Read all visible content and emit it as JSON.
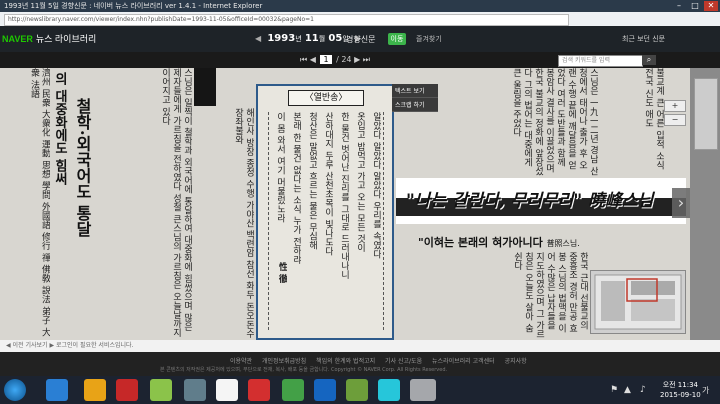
{
  "window": {
    "title": "1993년 11월 5일 경향신문 : 네이버 뉴스 라이브러리 ver 1.4.1 - Internet Explorer",
    "controls": [
      "–",
      "□",
      "✕"
    ]
  },
  "address_bar": {
    "url": "http://newslibrary.naver.com/viewer/index.nhn?publishDate=1993-11-05&officeId=00032&pageNo=1"
  },
  "app": {
    "brand": "NAVER",
    "brand_suffix": "뉴스 라이브러리",
    "date": {
      "year": "1993",
      "month": "11",
      "day": "05"
    },
    "date_unit_year": "년",
    "date_unit_month": "월",
    "date_unit_day": "일",
    "newspaper": "경향신문",
    "go_button": "이동",
    "favorite": "즐겨찾기",
    "recent": "최근 보던 신문"
  },
  "page_nav": {
    "current_page": "1",
    "total_pages": "/ 24",
    "search_placeholder": "검색 키워드를 입력",
    "search_icon": "search-icon"
  },
  "viewer": {
    "tooltip_items": [
      "텍스트 보기",
      "스크랩 하기"
    ],
    "next_arrow": "›",
    "zoom_in": "+",
    "zoom_out": "−",
    "boxed_title": "〈열반송〉",
    "poem_columns": [
      "알았다 알았다 알았다 우리를 속였다",
      "옷입고 밥먹고 가고 오는 모든 것이",
      "한 물건 벗어난 진리를 그대로 드러내나니",
      "산하대지 두루 산천초목이 빛나도다",
      "청산은 말없고 흐르는 물은 무심해",
      "본래 한 물건 없다는 소식 누가 전하랴",
      "이 몸 와서 여기 머물렀노라"
    ],
    "poem_signature": "性 徹",
    "left_headline_1": "철학·외국어도 통달",
    "left_headline_2": "의 대중화에도 힘써",
    "banner_headline": "\"나는 갈란다, 무리무리\" 曉峰스님",
    "sub_headline": "\"이혀는 본래의 혀가아니다",
    "sub_headline_small": "普照스님."
  },
  "hint_bar": {
    "text": "◀ 이전 기사보기    ▶ 로그인이 필요한 서비스입니다."
  },
  "footer": {
    "links": [
      "이용약관",
      "개인정보취급방침",
      "책임의 한계와 법적고지",
      "기사 신고/도움",
      "뉴스라이브러리 고객센터",
      "공지사항"
    ],
    "copyright": "본 콘텐츠의 저작권은 제공처에 있으며, 무단으로 전재, 복사, 배포 등을 금합니다.  Copyright © NAVER Corp. All Rights Reserved."
  },
  "taskbar": {
    "time": "오전 11:34",
    "date": "2015-09-10",
    "lang": "가"
  }
}
